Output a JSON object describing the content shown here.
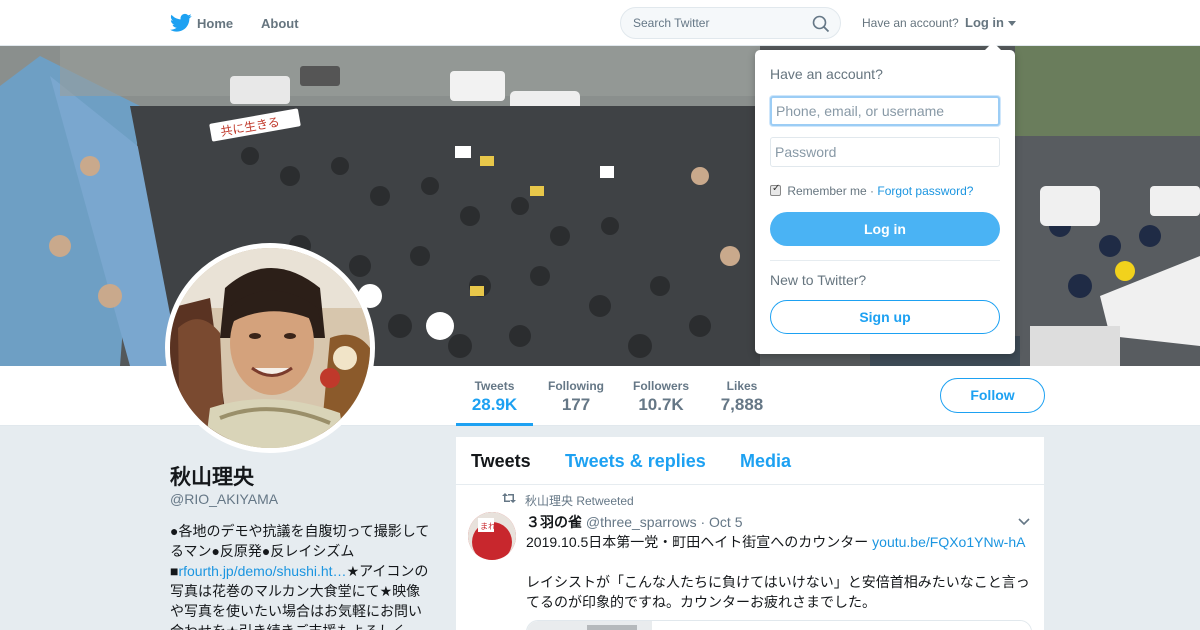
{
  "nav": {
    "home_label": "Home",
    "about_label": "About",
    "search_placeholder": "Search Twitter",
    "have_account_text": "Have an account?",
    "login_label": "Log in"
  },
  "profile": {
    "display_name": "秋山理央",
    "screen_name": "@RIO_AKIYAMA",
    "bio_line1": "●各地のデモや抗議を自腹切って撮影してるマン●反原発●反レイシズム■",
    "bio_link": "rfourth.jp/demo/shushi.ht…",
    "bio_line2": "★アイコンの写真は花巻のマルカン大食堂にて★映像や写真を使いたい場合はお気軽にお問い合わせを★引き続きご支援もよろしく"
  },
  "stats": [
    {
      "label": "Tweets",
      "value": "28.9K"
    },
    {
      "label": "Following",
      "value": "177"
    },
    {
      "label": "Followers",
      "value": "10.7K"
    },
    {
      "label": "Likes",
      "value": "7,888"
    }
  ],
  "follow_label": "Follow",
  "timeline": {
    "tabs": [
      "Tweets",
      "Tweets & replies",
      "Media"
    ],
    "tweet": {
      "retweeted_by": "秋山理央 Retweeted",
      "display_name": "３羽の雀",
      "screen_name": "@three_sparrows",
      "separator": "·",
      "date": "Oct 5",
      "text_line1": "2019.10.5日本第一党・町田ヘイト街宣へのカウンター ",
      "link": "youtu.be/FQXo1YNw-hA",
      "text_line2": "レイシストが「こんな人たちに負けてはいけない」と安倍首相みたいなこと言ってるのが印象的ですね。カウンターお疲れさまでした。"
    }
  },
  "login_dropdown": {
    "title": "Have an account?",
    "username_placeholder": "Phone, email, or username",
    "password_placeholder": "Password",
    "remember_label": "Remember me",
    "separator": "·",
    "forgot_label": "Forgot password?",
    "login_button": "Log in",
    "new_text": "New to Twitter?",
    "signup_button": "Sign up"
  },
  "colors": {
    "brand_blue": "#1da1f2",
    "link_blue": "#1b95e0",
    "page_bg": "#e6ecf0"
  }
}
